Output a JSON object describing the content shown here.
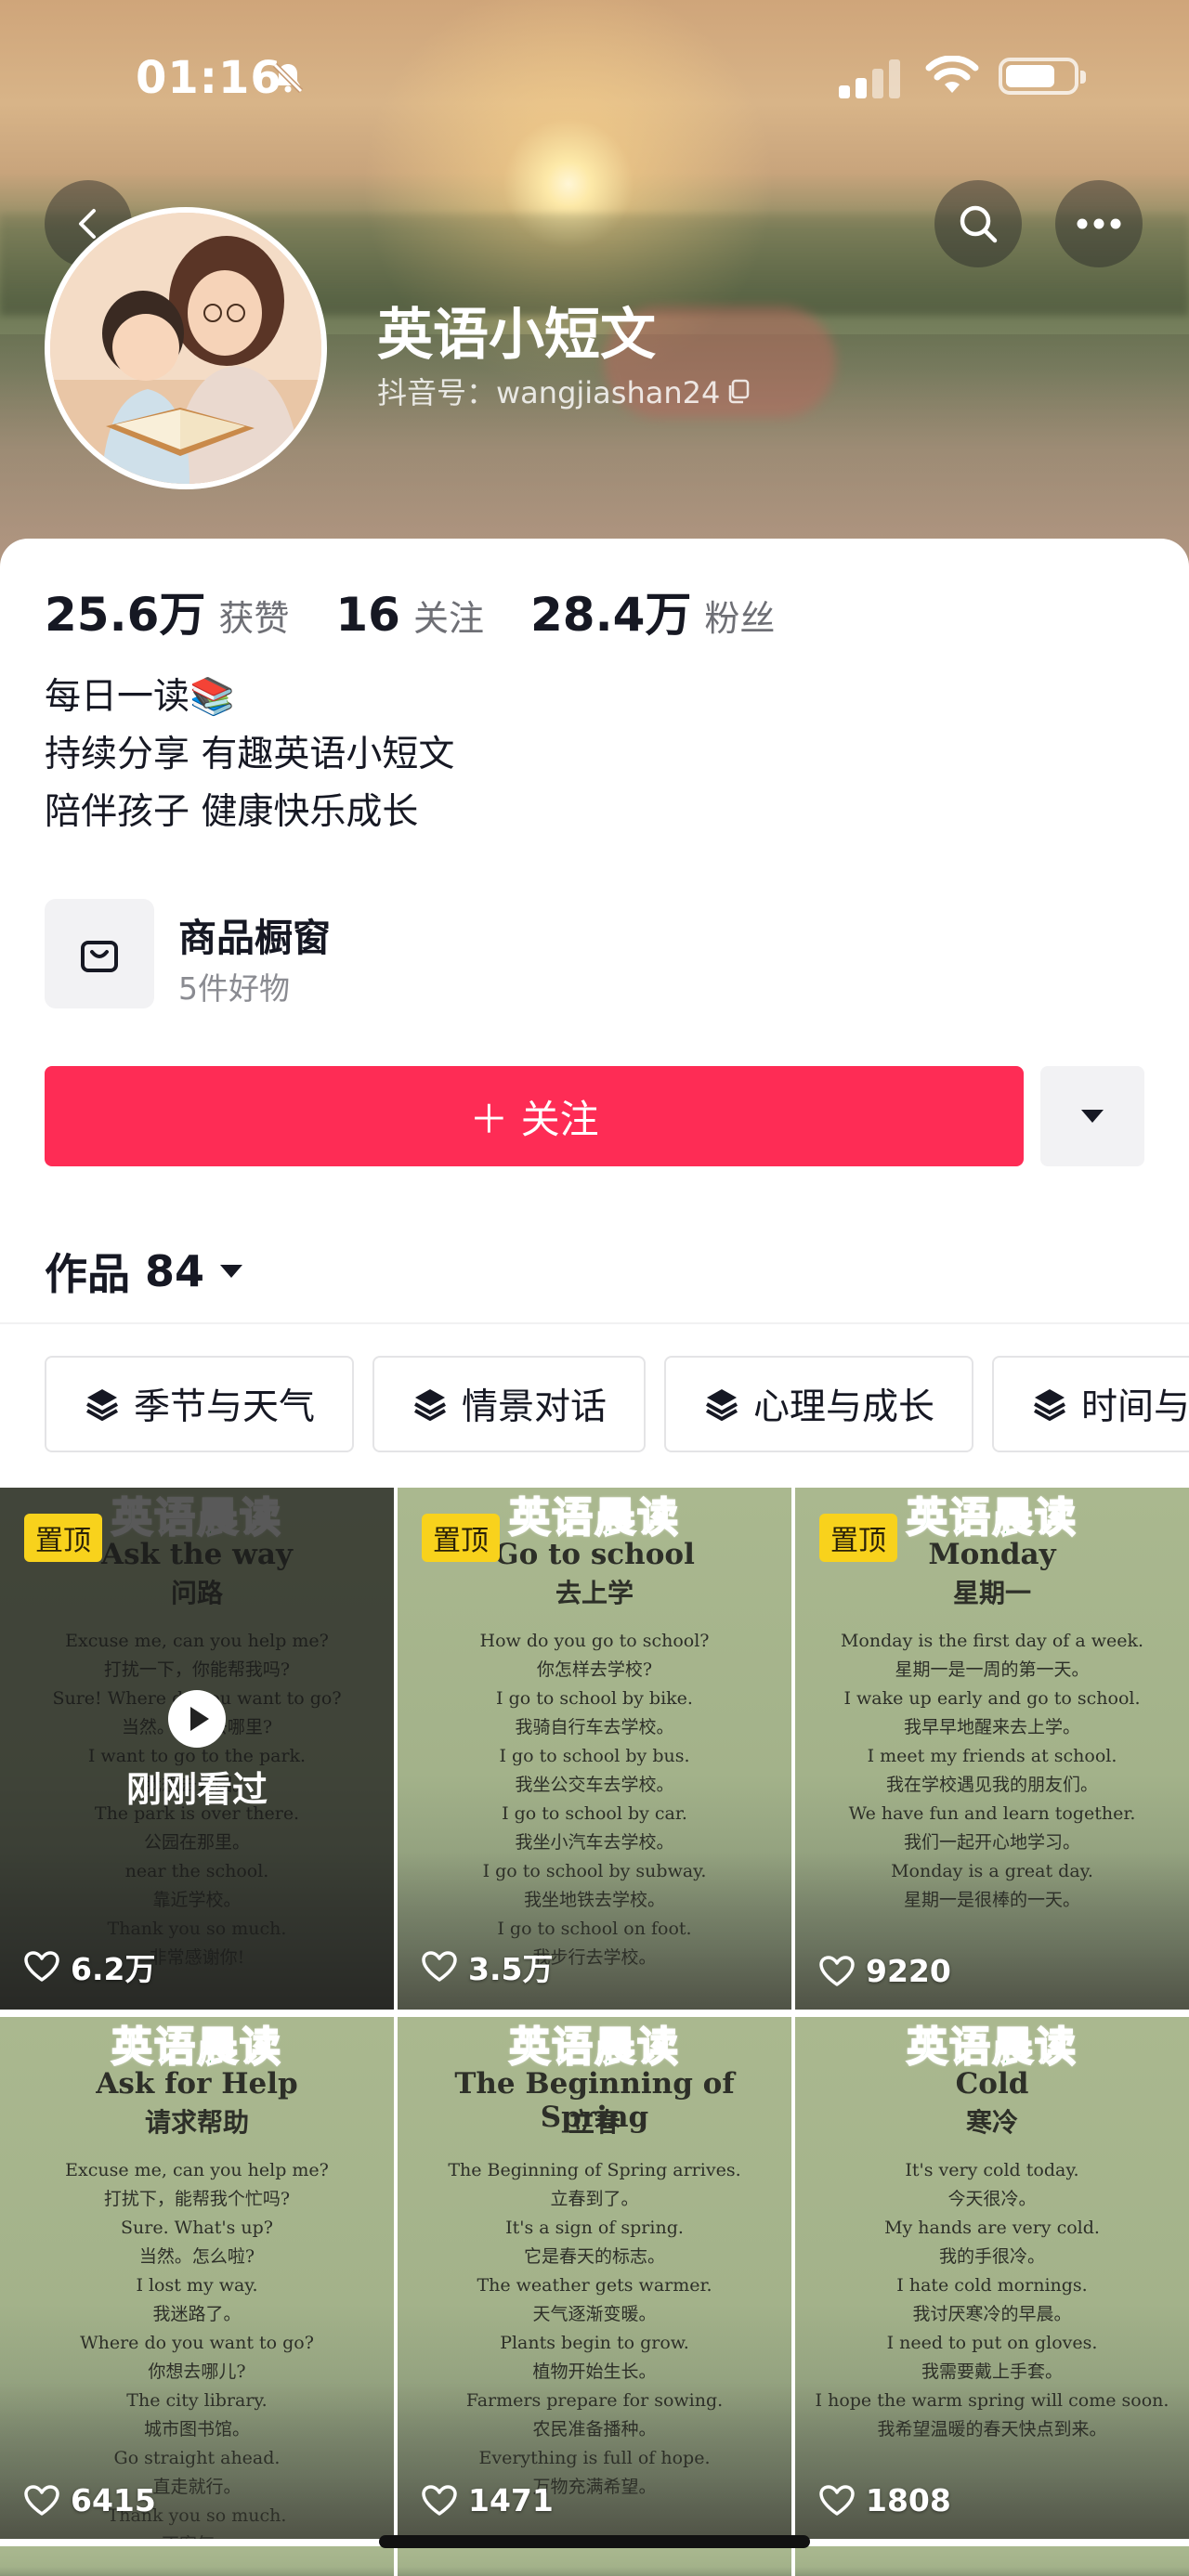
{
  "status": {
    "time": "01:16"
  },
  "profile": {
    "name": "英语小短文",
    "handle": "抖音号：wangjiashan24"
  },
  "stats": [
    {
      "value": "25.6万",
      "label": "获赞"
    },
    {
      "value": "16",
      "label": "关注"
    },
    {
      "value": "28.4万",
      "label": "粉丝"
    }
  ],
  "bio": [
    "每日一读📚",
    "持续分享 有趣英语小短文",
    "陪伴孩子 健康快乐成长"
  ],
  "shop": {
    "title": "商品橱窗",
    "subtitle": "5件好物"
  },
  "follow": {
    "label": "＋ 关注"
  },
  "works": {
    "label": "作品",
    "count": "84"
  },
  "chips": [
    "季节与天气",
    "情景对话",
    "心理与成长",
    "时间与节"
  ],
  "videos": [
    {
      "brand": "英语晨读",
      "title_en": "Ask the way",
      "title_zh": "问路",
      "pinned": "置顶",
      "likes": "6.2万",
      "seen": "刚刚看过",
      "lines": [
        "Excuse me, can you help me?",
        "打扰一下，你能帮我吗?",
        "Sure! Where do you want to go?",
        "当然。你想去哪里?",
        "I want to go to the park.",
        "我想去公园。",
        "The park is over there.",
        "公园在那里。",
        "near the school.",
        "靠近学校。",
        "Thank you so much.",
        "非常感谢你!"
      ]
    },
    {
      "brand": "英语晨读",
      "title_en": "Go to school",
      "title_zh": "去上学",
      "pinned": "置顶",
      "likes": "3.5万",
      "lines": [
        "How do you go to school?",
        "你怎样去学校?",
        "I go to school by bike.",
        "我骑自行车去学校。",
        "I go to school by bus.",
        "我坐公交车去学校。",
        "I go to school by car.",
        "我坐小汽车去学校。",
        "I go to school by subway.",
        "我坐地铁去学校。",
        "I go to school on foot.",
        "我步行去学校。"
      ]
    },
    {
      "brand": "英语晨读",
      "title_en": "Monday",
      "title_zh": "星期一",
      "pinned": "置顶",
      "likes": "9220",
      "lines": [
        "Monday is the first day of a week.",
        "星期一是一周的第一天。",
        "I wake up early and go to school.",
        "我早早地醒来去上学。",
        "I meet my friends at school.",
        "我在学校遇见我的朋友们。",
        "We have fun and learn together.",
        "我们一起开心地学习。",
        "Monday is a great day.",
        "星期一是很棒的一天。"
      ]
    },
    {
      "brand": "英语晨读",
      "title_en": "Ask for Help",
      "title_zh": "请求帮助",
      "likes": "6415",
      "lines": [
        "Excuse me, can you help me?",
        "打扰下，能帮我个忙吗?",
        "Sure. What's up?",
        "当然。怎么啦?",
        "I lost my way.",
        "我迷路了。",
        "Where do you want to go?",
        "你想去哪儿?",
        "The city library.",
        "城市图书馆。",
        "Go straight ahead.",
        "直走就行。",
        "Thank you so much.",
        "不客气。"
      ]
    },
    {
      "brand": "英语晨读",
      "title_en": "The Beginning of Spring",
      "title_zh": "立春",
      "likes": "1471",
      "lines": [
        "The Beginning of Spring arrives.",
        "立春到了。",
        "It's a sign of spring.",
        "它是春天的标志。",
        "The weather gets warmer.",
        "天气逐渐变暖。",
        "Plants begin to grow.",
        "植物开始生长。",
        "Farmers prepare for sowing.",
        "农民准备播种。",
        "Everything is full of hope.",
        "万物充满希望。"
      ]
    },
    {
      "brand": "英语晨读",
      "title_en": "Cold",
      "title_zh": "寒冷",
      "likes": "1808",
      "lines": [
        "It's very cold today.",
        "今天很冷。",
        "My hands are very cold.",
        "我的手很冷。",
        "I hate cold mornings.",
        "我讨厌寒冷的早晨。",
        "I need to put on gloves.",
        "我需要戴上手套。",
        "I hope the warm spring will come soon.",
        "我希望温暖的春天快点到来。"
      ]
    }
  ],
  "colors": {
    "accent": "#fe2c55",
    "pinned": "#f8d21c"
  }
}
